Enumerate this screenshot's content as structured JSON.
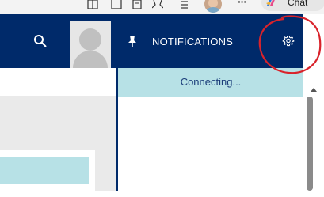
{
  "browser": {
    "chat_label": "Chat",
    "icons": [
      "split-screen-icon",
      "star-icon",
      "collections-icon",
      "favorites-icon",
      "profile-avatar",
      "more-icon",
      "copilot-icon"
    ]
  },
  "header": {
    "notifications_title": "NOTIFICATIONS",
    "background": "#002a6a"
  },
  "notifications": {
    "status": "Connecting..."
  },
  "colors": {
    "header": "#002a6a",
    "status_bar": "#b7e1e6",
    "annotation": "#d9232b"
  }
}
